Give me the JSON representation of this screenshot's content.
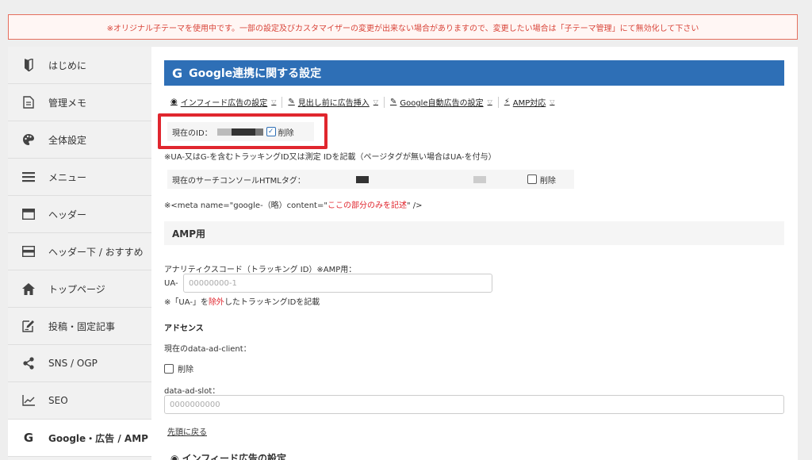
{
  "notice": "※オリジナル子テーマを使用中です。一部の設定及びカスタマイザーの変更が出来ない場合がありますので、変更したい場合は「子テーマ管理」にて無効化して下さい",
  "sidebar": {
    "items": [
      {
        "label": "はじめに",
        "icon": "beginner-icon"
      },
      {
        "label": "管理メモ",
        "icon": "memo-icon"
      },
      {
        "label": "全体設定",
        "icon": "palette-icon"
      },
      {
        "label": "メニュー",
        "icon": "menu-icon"
      },
      {
        "label": "ヘッダー",
        "icon": "header-icon"
      },
      {
        "label": "ヘッダー下 / おすすめ",
        "icon": "header-below-icon"
      },
      {
        "label": "トップページ",
        "icon": "home-icon"
      },
      {
        "label": "投稿・固定記事",
        "icon": "edit-icon"
      },
      {
        "label": "SNS / OGP",
        "icon": "share-icon"
      },
      {
        "label": "SEO",
        "icon": "chart-icon"
      },
      {
        "label": "Google・広告 / AMP",
        "icon": "google-icon",
        "active": true
      }
    ]
  },
  "main": {
    "title": "Google連携に関する設定",
    "title_icon": "G",
    "tabs": [
      {
        "label": "インフィード広告の設定",
        "icon": "pin-icon"
      },
      {
        "label": "見出し前に広告挿入",
        "icon": "pen-icon"
      },
      {
        "label": "Google自動広告の設定",
        "icon": "pen-icon"
      },
      {
        "label": "AMP対応",
        "icon": "bolt-icon"
      }
    ],
    "current_id_label": "現在のID：",
    "delete_label": "削除",
    "id_note": "※UA-又はG-を含むトラッキングID又は測定 IDを記載（ページタグが無い場合はUA-を付与）",
    "console_label": "現在のサーチコンソールHTMLタグ：",
    "meta_note_prefix": "※<meta name=\"google-（略）content=\"",
    "meta_note_red": "ここの部分のみを記述",
    "meta_note_suffix": "\"  />",
    "amp_section": "AMP用",
    "analytics_label": "アナリティクスコード（トラッキング ID）※AMP用：",
    "ua_prefix": "UA-",
    "ua_placeholder": "00000000-1",
    "ua_note_prefix": "※「UA-」を",
    "ua_note_red": "除外",
    "ua_note_suffix": "したトラッキングIDを記載",
    "adsense_head": "アドセンス",
    "client_label": "現在のdata-ad-client：",
    "slot_label": "data-ad-slot：",
    "slot_placeholder": "0000000000",
    "back_to_top": "先頭に戻る",
    "next_section": "インフィード広告の設定"
  },
  "colors": {
    "accent": "#2e6fb6",
    "highlight": "#e0262e",
    "notice": "#d9453a"
  }
}
